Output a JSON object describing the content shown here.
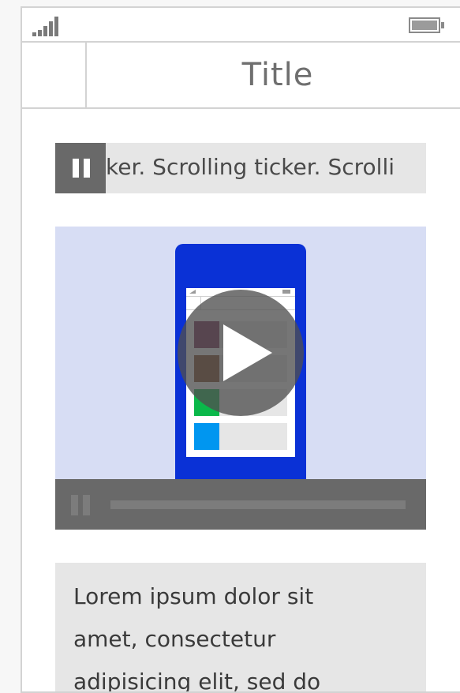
{
  "status_bar": {
    "signal_icon": "signal-strength-icon",
    "battery_icon": "battery-icon"
  },
  "title_bar": {
    "title": "Title"
  },
  "ticker": {
    "pause_icon": "pause-icon",
    "text": "ker. Scrolling ticker. Scrolli"
  },
  "video": {
    "play_icon": "play-icon",
    "pause_icon": "pause-icon",
    "thumbnail_swatches": [
      "#722050",
      "#7b3f1e",
      "#0ab84a",
      "#0096f0"
    ],
    "phone_color": "#0a31d6",
    "background_color": "#d7ddf4"
  },
  "body_text": {
    "text": "Lorem ipsum dolor sit amet, consectetur adipisicing elit, sed do"
  },
  "colors": {
    "frame_border": "#d3d3d3",
    "dark_control": "#696969",
    "panel_gray": "#e6e6e6"
  }
}
